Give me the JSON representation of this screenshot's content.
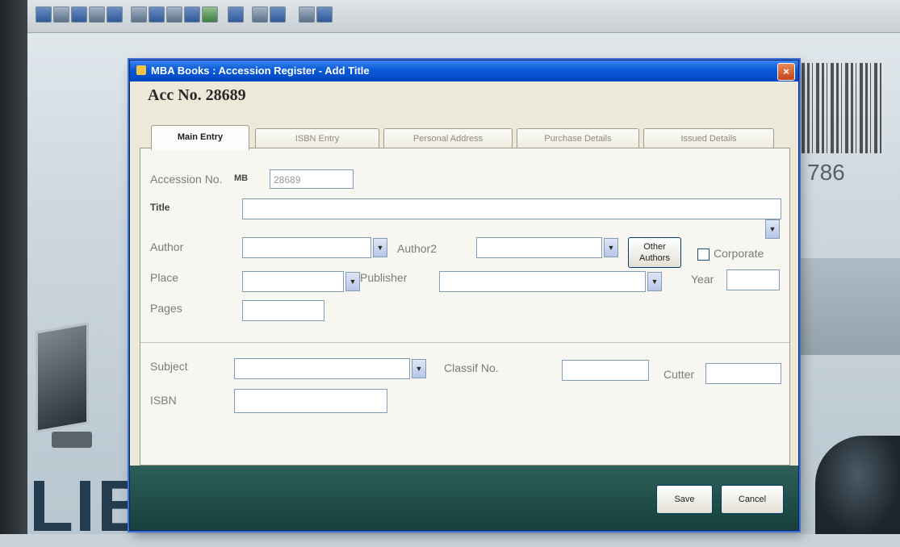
{
  "window": {
    "title": "MBA Books : Accession Register - Add Title",
    "close_glyph": "×"
  },
  "dialog": {
    "heading": "Acc No. 28689"
  },
  "tabs": [
    {
      "label": "Main Entry",
      "active": true
    },
    {
      "label": "ISBN Entry",
      "active": false
    },
    {
      "label": "Personal Address",
      "active": false
    },
    {
      "label": "Purchase Details",
      "active": false
    },
    {
      "label": "Issued Details",
      "active": false
    }
  ],
  "form": {
    "accession_label": "Accession No.",
    "accession_prefix": "MB",
    "accession_value": "28689",
    "title_label": "Title",
    "author_label": "Author",
    "author2_label": "Author2",
    "other_authors_label": "Other Authors",
    "corporate_label": "Corporate",
    "place_label": "Place",
    "publisher_label": "Publisher",
    "year_label": "Year",
    "pages_label": "Pages",
    "subject_label": "Subject",
    "classif_label": "Classif No.",
    "cutter_label": "Cutter",
    "isbn_label": "ISBN",
    "dropdown_glyph": "▼"
  },
  "footer": {
    "save_label": "Save",
    "cancel_label": "Cancel"
  },
  "background": {
    "barcode_number": "786",
    "brand_text": "LIBSUITE"
  },
  "colors": {
    "titlebar": "#0a5bd8",
    "dialog_bg": "#ece9d8",
    "footer_bar": "#1f4c47",
    "panel_bg": "#f7f6f1"
  }
}
